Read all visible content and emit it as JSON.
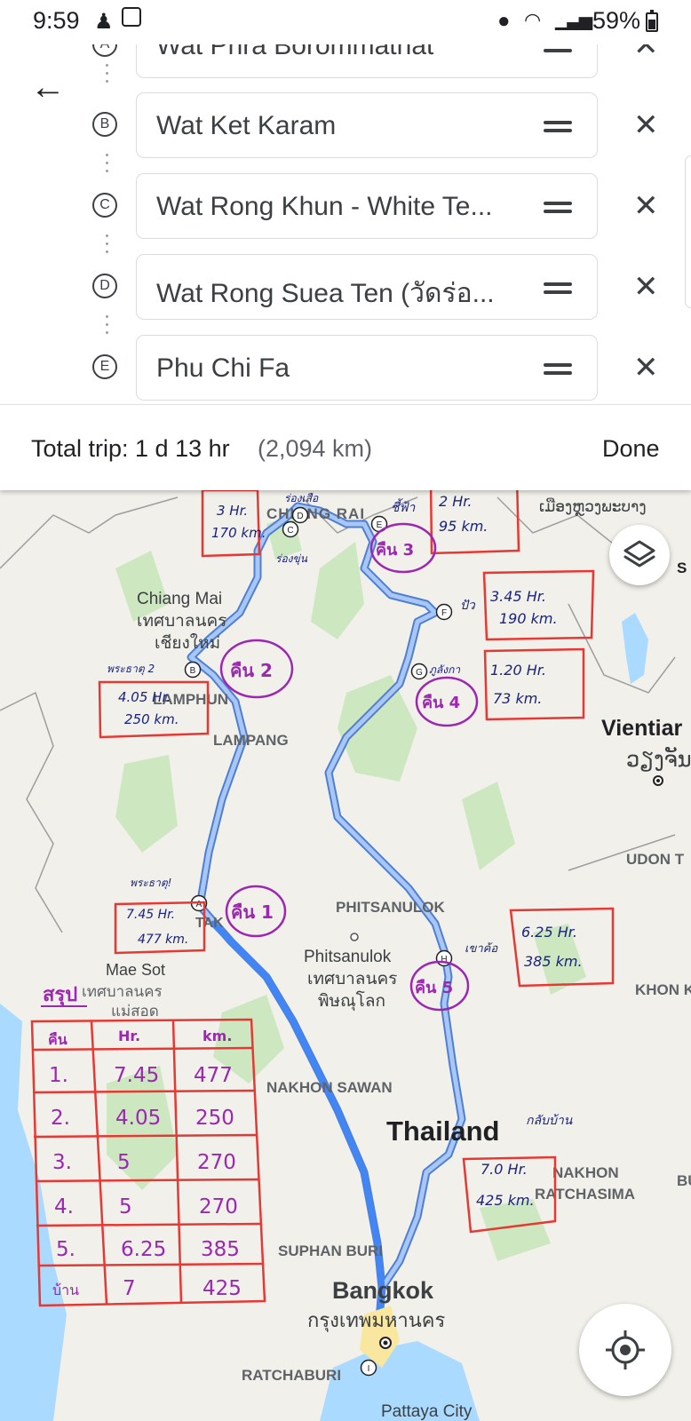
{
  "status_bar": {
    "time": "9:59",
    "battery": "59%"
  },
  "stops": [
    {
      "letter": "A",
      "name": "Wat Phra Borommathat"
    },
    {
      "letter": "B",
      "name": "Wat Ket Karam"
    },
    {
      "letter": "C",
      "name": "Wat Rong Khun - White Te..."
    },
    {
      "letter": "D",
      "name": "Wat Rong Suea Ten (วัดร่อ..."
    },
    {
      "letter": "E",
      "name": "Phu Chi Fa"
    }
  ],
  "trip": {
    "total": "Total trip: 1 d 13 hr",
    "distance": "(2,094 km)",
    "done": "Done"
  },
  "map": {
    "places": {
      "chiang_rai": "CHIANG RAI",
      "chiang_mai": "Chiang Mai",
      "chiang_mai_th1": "เทศบาลนคร",
      "chiang_mai_th2": "เชียงใหม่",
      "lamphun": "LAMPHUN",
      "lampang": "LAMPANG",
      "phitsanulok_prov": "PHITSANULOK",
      "phitsanulok": "Phitsanulok",
      "phitsanulok_th1": "เทศบาลนคร",
      "phitsanulok_th2": "พิษณุโลก",
      "mae_sot": "Mae Sot",
      "mae_sot_th1": "เทศบาลนคร",
      "mae_sot_th2": "แม่สอด",
      "tak": "TAK",
      "nakhon_sawan": "NAKHON SAWAN",
      "thailand": "Thailand",
      "nakhon_ratchasima1": "NAKHON",
      "nakhon_ratchasima2": "RATCHASIMA",
      "suphan_buri": "SUPHAN BURI",
      "bangkok": "Bangkok",
      "bangkok_th": "กรุงเทพมหานคร",
      "ratchaburi": "RATCHABURI",
      "pattaya": "Pattaya City",
      "vientiane": "Vientiar",
      "vientiane_th": "ວຽງຈັນ",
      "udon": "UDON T",
      "khon": "KHON K",
      "luang_prabang": "ເມືອງຫຼວງພະບາງ",
      "bu": "BU",
      "cut_s": "S"
    },
    "waypoints": [
      "A",
      "B",
      "C",
      "D",
      "E",
      "F",
      "G",
      "H",
      "I"
    ],
    "notes": {
      "d1_time": "7.45 Hr.",
      "d1_km": "477 km.",
      "d1_day": "คืน 1",
      "d1_wat": "พระธาตุ!",
      "d2_time": "4.05 Hr.",
      "d2_km": "250 km.",
      "d2_day": "คืน 2",
      "d2_wat": "พระธาตุ 2",
      "d3_time": "3 Hr.",
      "d3_km": "170 km.",
      "d3_day": "คืน 3",
      "rongsuea": "ร่องเสือ",
      "rongkhun": "ร่องขุ่น",
      "d3b_time": "2 Hr.",
      "d3b_km": "95 km.",
      "chifa": "ชี้ฟ้า",
      "f_time": "3.45 Hr.",
      "f_km": "190 km.",
      "f_name": "ปัว",
      "g_time": "1.20 Hr.",
      "g_km": "73 km.",
      "g_name": "ภูลังกา",
      "d4_day": "คืน 4",
      "h_time": "6.25 Hr.",
      "h_km": "385 km.",
      "h_name": "เขาค้อ",
      "d5_day": "คืน 5",
      "home_time": "7.0 Hr.",
      "home_km": "425 km.",
      "home_name": "กลับบ้าน"
    },
    "summary": {
      "title": "สรุป",
      "headers": [
        "คืน",
        "Hr.",
        "km."
      ],
      "rows": [
        [
          "1.",
          "7.45",
          "477"
        ],
        [
          "2.",
          "4.05",
          "250"
        ],
        [
          "3.",
          "5",
          "270"
        ],
        [
          "4.",
          "5",
          "270"
        ],
        [
          "5.",
          "6.25",
          "385"
        ],
        [
          "บ้าน",
          "7",
          "425"
        ]
      ]
    }
  }
}
